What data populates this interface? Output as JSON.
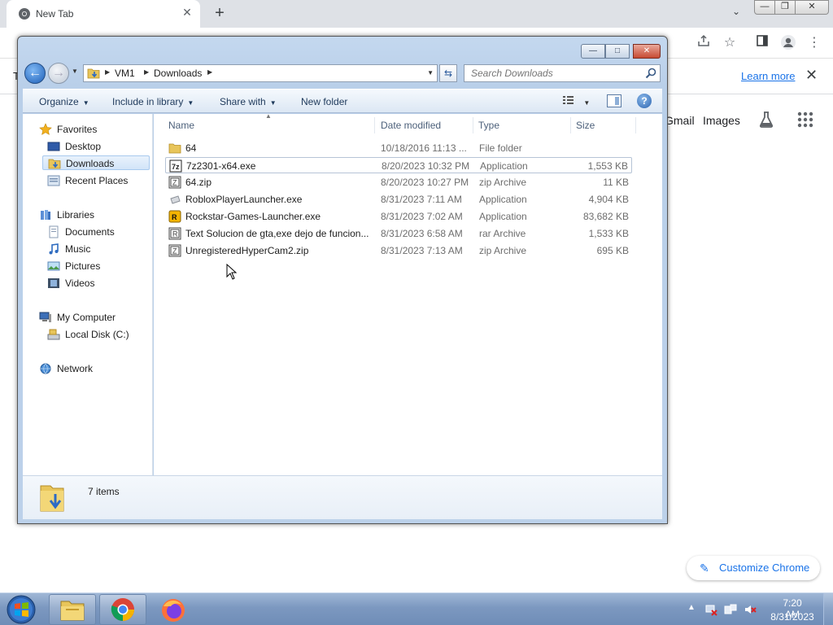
{
  "chrome": {
    "tab_title": "New Tab",
    "tab_close_glyph": "✕",
    "new_tab_glyph": "+",
    "tab_search_glyph": "⌄",
    "infobar_text": "T",
    "learn_more": "Learn more",
    "infobar_close_glyph": "✕",
    "ntp": {
      "gmail": "Gmail",
      "images": "Images"
    },
    "customize_label": "Customize Chrome",
    "accent_color": "#1a73e8"
  },
  "explorer": {
    "breadcrumb": [
      "VM1",
      "Downloads"
    ],
    "search_placeholder": "Search Downloads",
    "commands": {
      "organize": "Organize",
      "include_in_library": "Include in library",
      "share_with": "Share with",
      "new_folder": "New folder"
    },
    "nav": {
      "favorites": "Favorites",
      "desktop": "Desktop",
      "downloads": "Downloads",
      "recent_places": "Recent Places",
      "libraries": "Libraries",
      "documents": "Documents",
      "music": "Music",
      "pictures": "Pictures",
      "videos": "Videos",
      "my_computer": "My Computer",
      "local_disk": "Local Disk (C:)",
      "network": "Network"
    },
    "columns": {
      "name": "Name",
      "date": "Date modified",
      "type": "Type",
      "size": "Size"
    },
    "files": [
      {
        "name": "64",
        "date": "10/18/2016 11:13 ...",
        "type": "File folder",
        "size": "",
        "icon": "folder-icon"
      },
      {
        "name": "7z2301-x64.exe",
        "date": "8/20/2023 10:32 PM",
        "type": "Application",
        "size": "1,553 KB",
        "icon": "7zip-exe-icon"
      },
      {
        "name": "64.zip",
        "date": "8/20/2023 10:27 PM",
        "type": "zip Archive",
        "size": "11 KB",
        "icon": "zip-archive-icon"
      },
      {
        "name": "RobloxPlayerLauncher.exe",
        "date": "8/31/2023 7:11 AM",
        "type": "Application",
        "size": "4,904 KB",
        "icon": "roblox-icon"
      },
      {
        "name": "Rockstar-Games-Launcher.exe",
        "date": "8/31/2023 7:02 AM",
        "type": "Application",
        "size": "83,682 KB",
        "icon": "rockstar-icon"
      },
      {
        "name": "Text Solucion de gta,exe dejo de funcion...",
        "date": "8/31/2023 6:58 AM",
        "type": "rar Archive",
        "size": "1,533 KB",
        "icon": "rar-archive-icon"
      },
      {
        "name": "UnregisteredHyperCam2.zip",
        "date": "8/31/2023 7:13 AM",
        "type": "zip Archive",
        "size": "695 KB",
        "icon": "zip-archive-icon"
      }
    ],
    "status": "7 items"
  },
  "taskbar": {
    "time": "7:20 AM",
    "date": "8/31/2023"
  }
}
